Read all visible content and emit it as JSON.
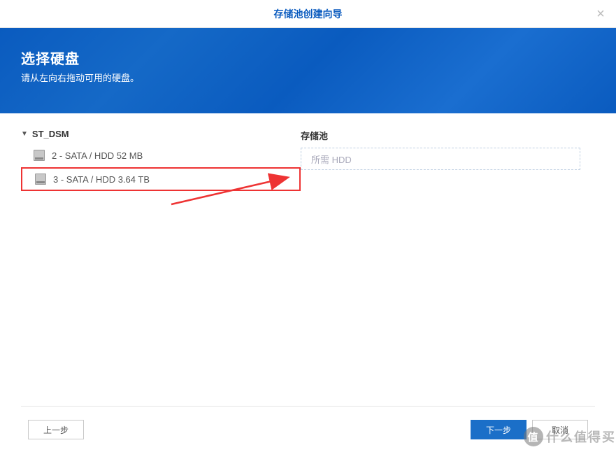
{
  "title": "存储池创建向导",
  "header": {
    "heading": "选择硬盘",
    "subtext": "请从左向右拖动可用的硬盘。"
  },
  "available": {
    "root_label": "ST_DSM",
    "disks": [
      {
        "label": "2 - SATA / HDD 52 MB",
        "highlighted": false
      },
      {
        "label": "3 - SATA / HDD 3.64 TB",
        "highlighted": true
      }
    ]
  },
  "pool": {
    "label": "存储池",
    "dropzone_placeholder": "所需 HDD"
  },
  "buttons": {
    "prev": "上一步",
    "next": "下一步",
    "cancel": "取消"
  },
  "watermark": {
    "badge": "值",
    "text": "什么值得买"
  }
}
